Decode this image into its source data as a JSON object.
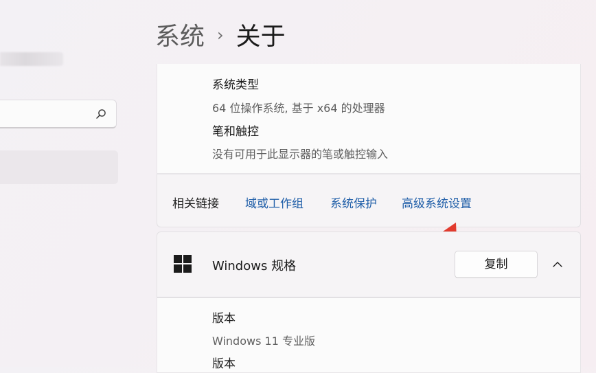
{
  "header": {
    "breadcrumb_parent": "系统",
    "breadcrumb_separator": "›",
    "breadcrumb_current": "关于"
  },
  "sidebar": {
    "search": {
      "value": "",
      "icon": "search-icon"
    }
  },
  "device_specs": {
    "rows": [
      {
        "label": "系统类型",
        "value": "64 位操作系统, 基于 x64 的处理器"
      },
      {
        "label": "笔和触控",
        "value": "没有可用于此显示器的笔或触控输入"
      }
    ]
  },
  "related_links": {
    "label": "相关链接",
    "links": [
      "域或工作组",
      "系统保护",
      "高级系统设置"
    ]
  },
  "windows_specs": {
    "title": "Windows 规格",
    "copy_button": "复制",
    "rows": [
      {
        "label": "版本",
        "value": "Windows 11 专业版"
      },
      {
        "label": "版本",
        "value": ""
      }
    ]
  },
  "colors": {
    "link": "#1f5ea8",
    "annotation_arrow": "#e23b2e",
    "card": "#fbfbfb"
  }
}
